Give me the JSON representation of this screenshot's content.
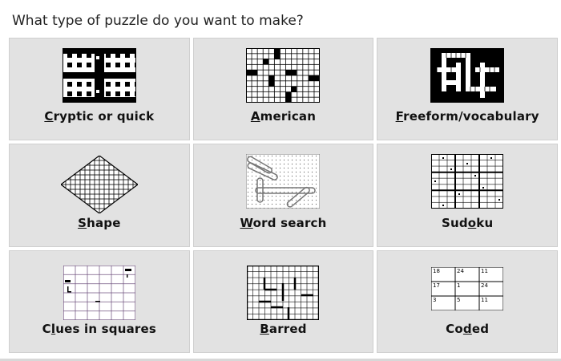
{
  "question": "What type of puzzle do you want to make?",
  "tiles": [
    {
      "id": "cryptic",
      "before": "",
      "key": "C",
      "after": "ryptic or quick",
      "label": "Cryptic or quick",
      "icon": "blocked-crossword-grid-icon"
    },
    {
      "id": "american",
      "before": "",
      "key": "A",
      "after": "merican",
      "label": "American",
      "icon": "american-crossword-grid-icon"
    },
    {
      "id": "freeform",
      "before": "",
      "key": "F",
      "after": "reeform/vocabulary",
      "label": "Freeform/vocabulary",
      "icon": "freeform-grid-icon"
    },
    {
      "id": "shape",
      "before": "",
      "key": "S",
      "after": "hape",
      "label": "Shape",
      "icon": "diamond-shape-grid-icon"
    },
    {
      "id": "wordsearch",
      "before": "",
      "key": "W",
      "after": "ord search",
      "label": "Word search",
      "icon": "word-search-grid-icon"
    },
    {
      "id": "sudoku",
      "before": "Sud",
      "key": "o",
      "after": "ku",
      "label": "Sudoku",
      "icon": "sudoku-grid-icon"
    },
    {
      "id": "clues",
      "before": "C",
      "key": "l",
      "after": "ues in squares",
      "label": "Clues in squares",
      "icon": "clues-in-squares-grid-icon"
    },
    {
      "id": "barred",
      "before": "",
      "key": "B",
      "after": "arred",
      "label": "Barred",
      "icon": "barred-grid-icon"
    },
    {
      "id": "coded",
      "before": "Co",
      "key": "d",
      "after": "ed",
      "label": "Coded",
      "icon": "coded-grid-icon"
    }
  ],
  "coded_numbers": [
    "18",
    "24",
    "11",
    "17",
    "1",
    "24",
    "3",
    "5",
    "11"
  ]
}
